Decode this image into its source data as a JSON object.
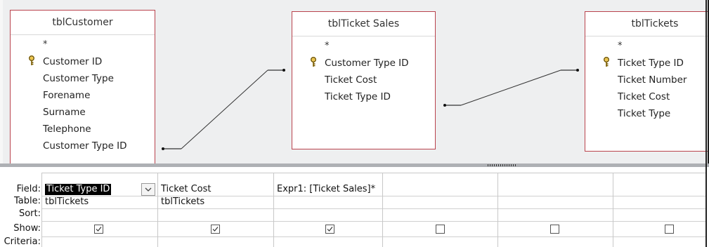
{
  "relationship_pane": {
    "tables": [
      {
        "name": "tblCustomer",
        "fields": [
          "*",
          "Customer ID",
          "Customer Type",
          "Forename",
          "Surname",
          "Telephone",
          "Customer Type ID"
        ],
        "primary_key": "Customer ID"
      },
      {
        "name": "tblTicket Sales",
        "fields": [
          "*",
          "Customer Type ID",
          "Ticket Cost",
          "Ticket Type ID"
        ],
        "primary_key": "Customer Type ID"
      },
      {
        "name": "tblTickets",
        "fields": [
          "*",
          "Ticket Type ID",
          "Ticket Number",
          "Ticket Cost",
          "Ticket Type"
        ],
        "primary_key": "Ticket Type ID"
      }
    ]
  },
  "design_grid": {
    "row_labels": [
      "Field:",
      "Table:",
      "Sort:",
      "Show:",
      "Criteria:"
    ],
    "columns": [
      {
        "field": "Ticket Type ID",
        "table": "tblTickets",
        "sort": "",
        "show": true
      },
      {
        "field": "Ticket Cost",
        "table": "tblTickets",
        "sort": "",
        "show": true
      },
      {
        "field": "Expr1: [Ticket Sales]*",
        "table": "",
        "sort": "",
        "show": true
      },
      {
        "field": "",
        "table": "",
        "sort": "",
        "show": false
      },
      {
        "field": "",
        "table": "",
        "sort": "",
        "show": false
      },
      {
        "field": "",
        "table": "",
        "sort": "",
        "show": false
      }
    ]
  },
  "icons": {
    "key": "key-icon",
    "dropdown": "chevron-down-icon",
    "check": "checkmark-icon"
  },
  "colors": {
    "table_border": "#b9434d",
    "selection": "#000000"
  }
}
